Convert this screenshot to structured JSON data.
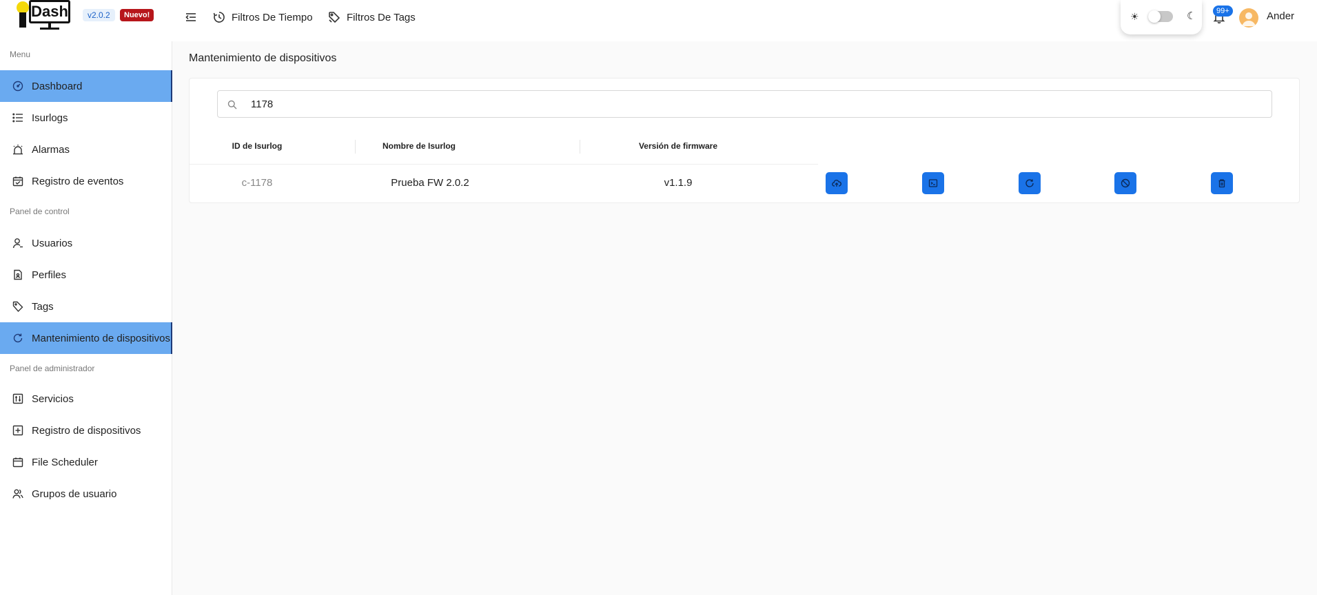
{
  "header": {
    "logo_text": "Dash",
    "version": "v2.0.2",
    "new_badge": "Nuevo!",
    "nav": [
      {
        "label": "Filtros De Tiempo",
        "icon": "clock-history-icon"
      },
      {
        "label": "Filtros De Tags",
        "icon": "tags-icon"
      }
    ],
    "notifications_count": "99+",
    "user_name": "Ander"
  },
  "sidebar": {
    "sections": [
      {
        "label": "Menu"
      },
      {
        "label": "Panel de control"
      },
      {
        "label": "Panel de administrador"
      }
    ],
    "items": [
      {
        "label": "Dashboard",
        "icon": "speedometer-icon",
        "active": true
      },
      {
        "label": "Isurlogs",
        "icon": "list-icon",
        "active": false
      },
      {
        "label": "Alarmas",
        "icon": "alarm-icon",
        "active": false
      },
      {
        "label": "Registro de eventos",
        "icon": "calendar-events-icon",
        "active": false
      },
      {
        "label": "Usuarios",
        "icon": "user-icon",
        "active": false
      },
      {
        "label": "Perfiles",
        "icon": "profile-document-icon",
        "active": false
      },
      {
        "label": "Tags",
        "icon": "tag-icon",
        "active": false
      },
      {
        "label": "Mantenimiento de dispositivos",
        "icon": "refresh-icon",
        "active": true
      },
      {
        "label": "Servicios",
        "icon": "sliders-icon",
        "active": false
      },
      {
        "label": "Registro de dispositivos",
        "icon": "plus-square-icon",
        "active": false
      },
      {
        "label": "File Scheduler",
        "icon": "calendar-icon",
        "active": false
      },
      {
        "label": "Grupos de usuario",
        "icon": "users-group-icon",
        "active": false
      }
    ]
  },
  "main": {
    "title": "Mantenimiento de dispositivos",
    "search": {
      "value": "1178",
      "placeholder": ""
    },
    "table": {
      "headers": [
        "ID de Isurlog",
        "Nombre de Isurlog",
        "Versión de firmware"
      ],
      "rows": [
        {
          "id": "c-1178",
          "name": "Prueba FW 2.0.2",
          "firmware": "v1.1.9"
        }
      ],
      "actions": [
        "upload-cloud-icon",
        "terminal-icon",
        "refresh-icon",
        "block-icon",
        "trash-icon"
      ]
    }
  },
  "colors": {
    "accent": "#1a73e8",
    "active_item_bg": "#6aaaf0",
    "new_badge_bg": "#b7161b"
  }
}
